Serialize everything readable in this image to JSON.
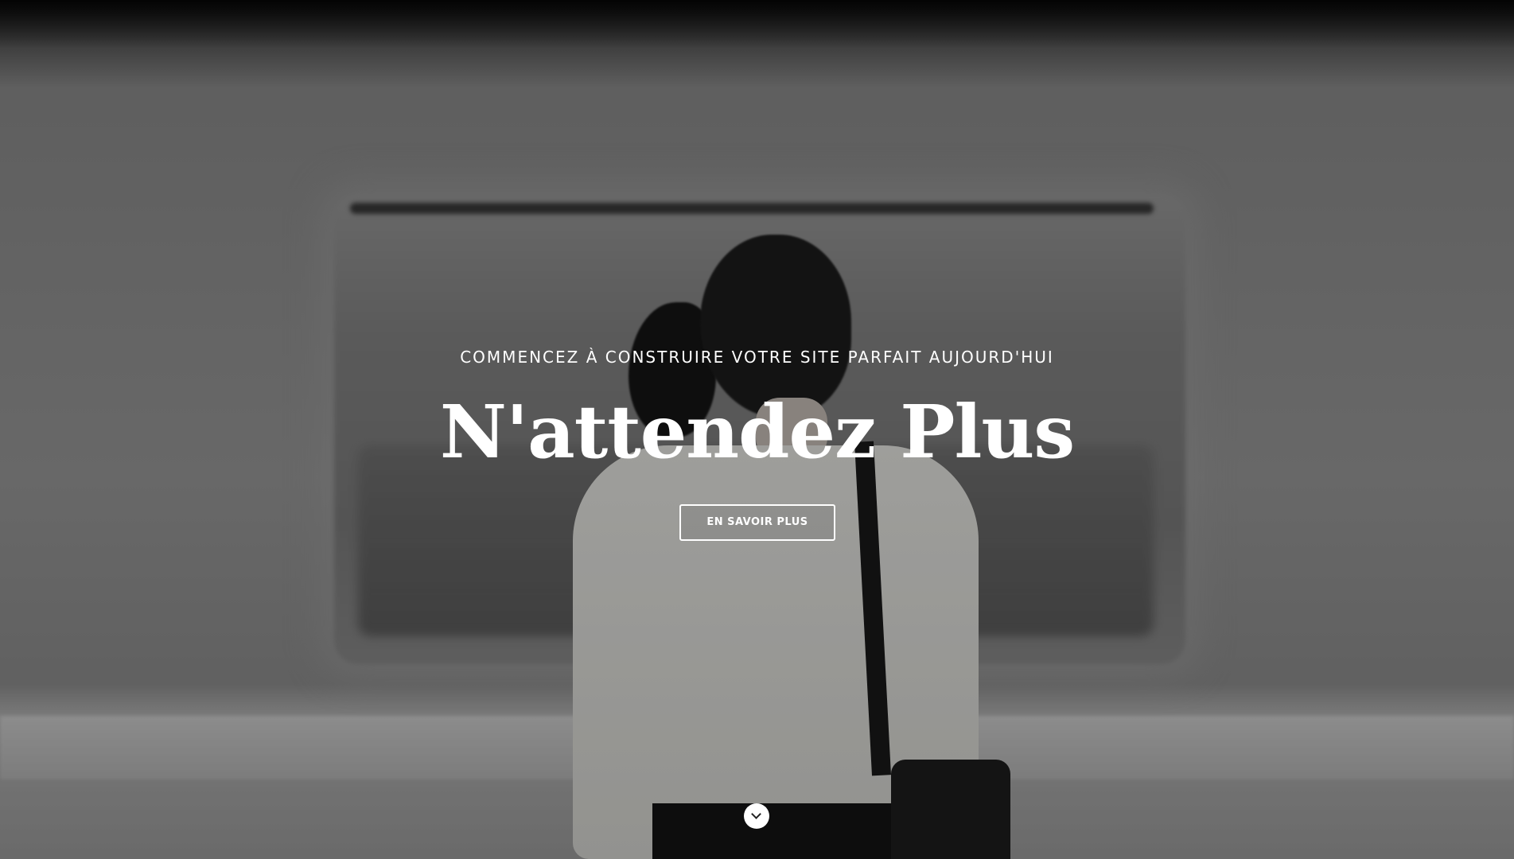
{
  "hero": {
    "subtitle": "COMMENCEZ À CONSTRUIRE VOTRE SITE PARFAIT AUJOURD'HUI",
    "headline": "N'attendez Plus",
    "cta_label": "EN SAVOIR PLUS",
    "scroll_icon": "chevron-down-icon"
  },
  "colors": {
    "text": "#ffffff",
    "overlay": "rgba(0,0,0,0.32)"
  }
}
